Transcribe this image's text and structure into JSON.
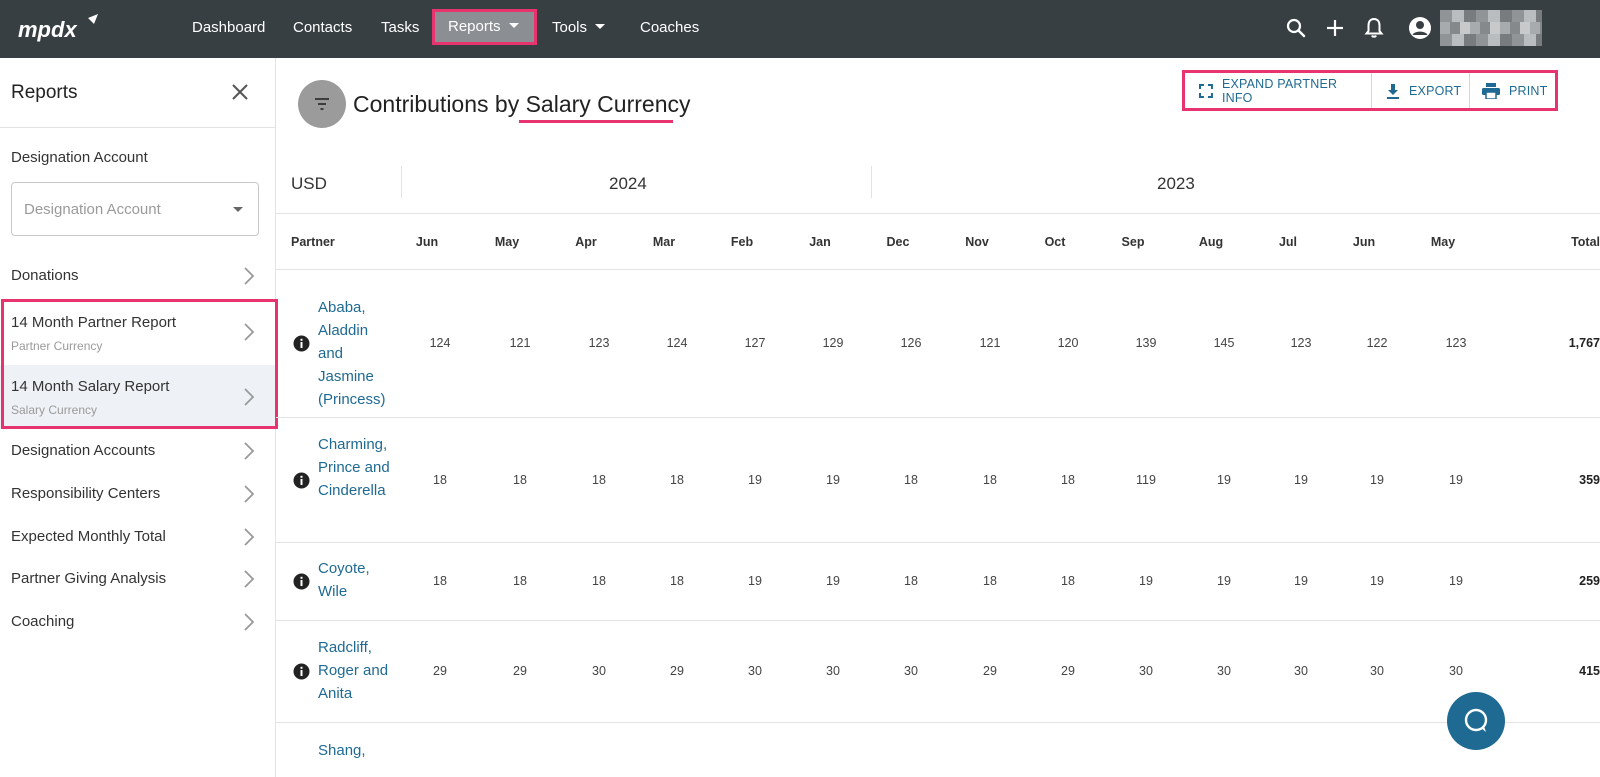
{
  "nav": {
    "logo_text": "mpdx",
    "items": [
      "Dashboard",
      "Contacts",
      "Tasks",
      "Reports",
      "Tools",
      "Coaches"
    ],
    "icons": [
      "search-icon",
      "add-icon",
      "notifications-icon",
      "account-icon"
    ]
  },
  "sidebar": {
    "title": "Reports",
    "designation_label": "Designation Account",
    "designation_placeholder": "Designation Account",
    "items": [
      {
        "label": "Donations",
        "sub": ""
      },
      {
        "label": "14 Month Partner Report",
        "sub": "Partner Currency"
      },
      {
        "label": "14 Month Salary Report",
        "sub": "Salary Currency"
      },
      {
        "label": "Designation Accounts",
        "sub": ""
      },
      {
        "label": "Responsibility Centers",
        "sub": ""
      },
      {
        "label": "Expected Monthly Total",
        "sub": ""
      },
      {
        "label": "Partner Giving Analysis",
        "sub": ""
      },
      {
        "label": "Coaching",
        "sub": ""
      }
    ]
  },
  "main": {
    "title_prefix": "Contributions by ",
    "title_emphasis": "Salary Currency",
    "actions": [
      "EXPAND PARTNER INFO",
      "EXPORT",
      "PRINT"
    ],
    "currency": "USD",
    "years": [
      "2024",
      "2023"
    ],
    "columns": [
      "Partner",
      "Jun",
      "May",
      "Apr",
      "Mar",
      "Feb",
      "Jan",
      "Dec",
      "Nov",
      "Oct",
      "Sep",
      "Aug",
      "Jul",
      "Jun",
      "May",
      "Total"
    ],
    "rows": [
      {
        "name": "Ababa, Aladdin and Jasmine (Princess)",
        "values": [
          "124",
          "121",
          "123",
          "124",
          "127",
          "129",
          "126",
          "121",
          "120",
          "139",
          "145",
          "123",
          "122",
          "123"
        ],
        "total": "1,767"
      },
      {
        "name": "Charming, Prince and Cinderella",
        "values": [
          "18",
          "18",
          "18",
          "18",
          "19",
          "19",
          "18",
          "18",
          "18",
          "119",
          "19",
          "19",
          "19",
          "19"
        ],
        "total": "359"
      },
      {
        "name": "Coyote, Wile",
        "values": [
          "18",
          "18",
          "18",
          "18",
          "19",
          "19",
          "18",
          "18",
          "18",
          "19",
          "19",
          "19",
          "19",
          "19"
        ],
        "total": "259"
      },
      {
        "name": "Radcliff, Roger and Anita",
        "values": [
          "29",
          "29",
          "30",
          "29",
          "30",
          "30",
          "30",
          "29",
          "29",
          "30",
          "30",
          "30",
          "30",
          "30"
        ],
        "total": "415"
      },
      {
        "name": "Shang,",
        "values": [],
        "total": ""
      }
    ]
  },
  "colors": {
    "topbar": "#383f43",
    "accent_link": "#1f6a93",
    "highlight": "#e8346e",
    "active_bg": "#eef2f6"
  }
}
